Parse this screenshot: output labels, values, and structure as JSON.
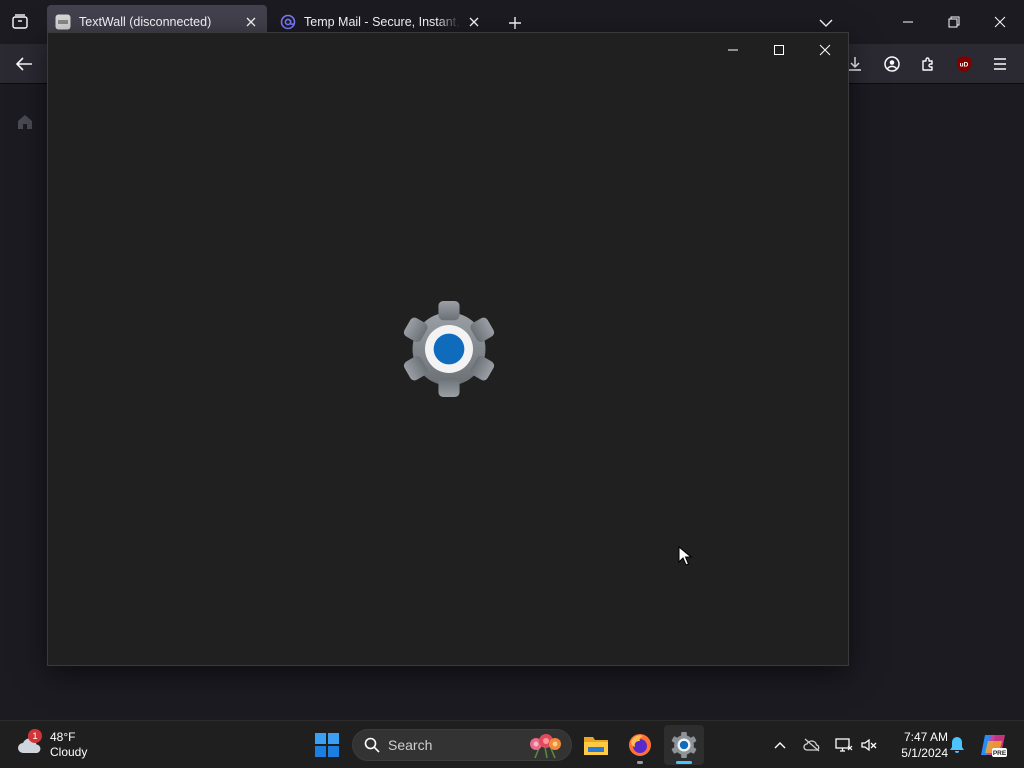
{
  "browser": {
    "tabs": [
      {
        "title": "TextWall (disconnected)",
        "active": true,
        "favicon": "textwall-favicon"
      },
      {
        "title": "Temp Mail - Secure, Instant, Fast",
        "active": false,
        "favicon": "at-sign-icon"
      }
    ],
    "toolbar_icons": [
      "back-icon",
      "download-icon",
      "account-icon",
      "extensions-icon",
      "ublock-icon",
      "menu-icon"
    ],
    "ublock_badge": "uD"
  },
  "settings_window": {
    "icon": "settings-gear-icon",
    "controls": [
      "minimize",
      "maximize",
      "close"
    ]
  },
  "taskbar": {
    "weather": {
      "badge": "1",
      "temperature": "48°F",
      "condition": "Cloudy"
    },
    "search_label": "Search",
    "apps": [
      "file-explorer-icon",
      "firefox-icon",
      "settings-icon"
    ],
    "clock": {
      "time": "7:47 AM",
      "date": "5/1/2024"
    },
    "copilot_badge": "PRE"
  },
  "colors": {
    "accent": "#0f6cbd",
    "browser_bg": "#1c1b22",
    "window_bg": "#202020",
    "taskbar_bg": "#1f1f1f"
  }
}
